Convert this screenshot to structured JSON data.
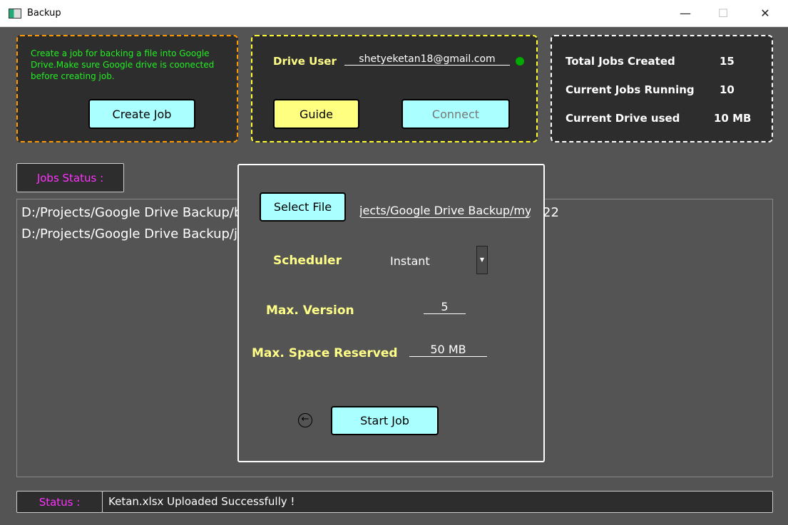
{
  "window": {
    "title": "Backup",
    "minimize": "—",
    "maximize": "☐",
    "close": "✕"
  },
  "create_panel": {
    "description": "Create a job for backing a file into Google Drive.Make sure Google drive is coonected before creating job.",
    "create_button": "Create Job"
  },
  "drive_panel": {
    "user_label": "Drive User",
    "user_email": "shetyeketan18@gmail.com",
    "status_color": "#00aa00",
    "guide_button": "Guide",
    "connect_button": "Connect"
  },
  "stats": {
    "total_label": "Total Jobs Created",
    "total_value": "15",
    "running_label": "Current Jobs Running",
    "running_value": "10",
    "drive_label": "Current Drive used",
    "drive_value": "10 MB"
  },
  "jobs": {
    "label": "Jobs Status :",
    "items": [
      "D:/Projects/Google Drive Backup/b",
      "D:/Projects/Google Drive Backup/jo"
    ],
    "overflow_fragment": "22"
  },
  "dialog": {
    "select_file_button": "Select File",
    "file_path": "jects/Google Drive Backup/mycr",
    "scheduler_label": "Scheduler",
    "scheduler_value": "Instant",
    "max_version_label": "Max. Version",
    "max_version_value": "5",
    "max_space_label": "Max. Space Reserved",
    "max_space_value": "50 MB",
    "start_button": "Start Job"
  },
  "status": {
    "label": "Status :",
    "message": "Ketan.xlsx Uploaded Successfully !"
  }
}
